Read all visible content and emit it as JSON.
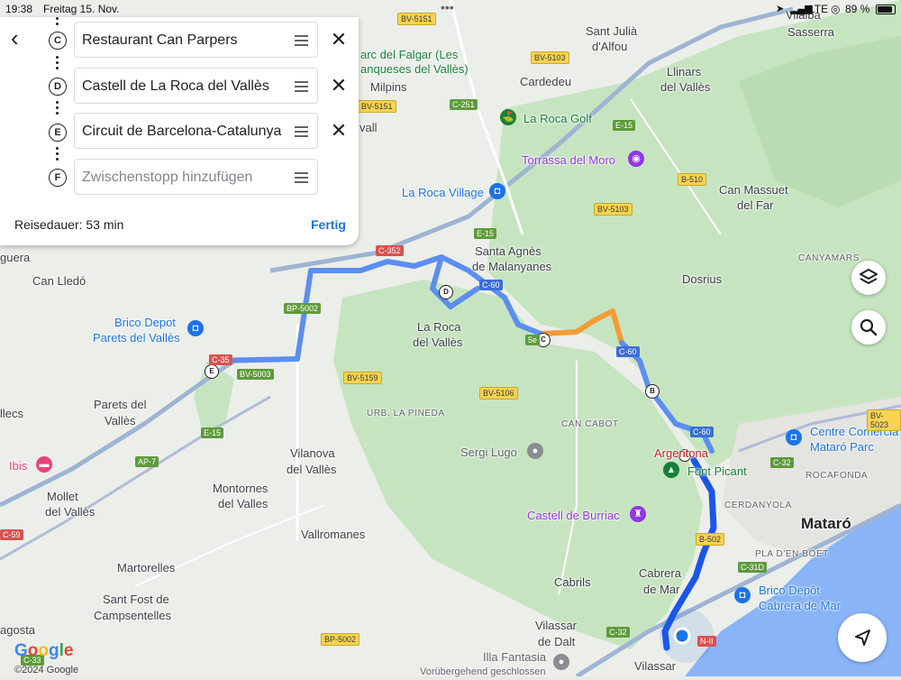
{
  "status_bar": {
    "time": "19:38",
    "date": "Freitag 15. Nov.",
    "carrier": "LTE",
    "battery": "89 %"
  },
  "directions": {
    "stops": [
      {
        "letter": "C",
        "value": "Restaurant Can Parpers"
      },
      {
        "letter": "D",
        "value": "Castell de La Roca del Vallès"
      },
      {
        "letter": "E",
        "value": "Circuit de Barcelona-Catalunya"
      },
      {
        "letter": "F",
        "value": "",
        "placeholder": "Zwischenstopp hinzufügen"
      }
    ],
    "duration": "Reisedauer: 53 min",
    "done_label": "Fertig"
  },
  "map": {
    "towns": {
      "vilalba": "Vilalba",
      "sasserra": "Sasserra",
      "sant_julia": "Sant Julià",
      "d_alfou": "d'Alfou",
      "cardedeu": "Cardedeu",
      "llinars": "Llinars",
      "del_valles": "del Vallès",
      "milpins": "Milpins",
      "vall": "vall",
      "can_massuet": "Can Massuet",
      "del_far": "del Far",
      "santa_agnes": "Santa Agnès",
      "de_malanyanes": "de Malanyanes",
      "dosrius": "Dosrius",
      "guera": "guera",
      "can_lledo": "Can Lledó",
      "la_roca": "La Roca",
      "la_roca_2": "del Vallès",
      "parets": "Parets del",
      "parets_2": "Vallès",
      "llecs": "llecs",
      "vilanova": "Vilanova",
      "vilanova_2": "del Vallès",
      "montornes": "Montornes",
      "montornes_2": "del Valles",
      "mollet": "Mollet",
      "mollet_2": "del Vallès",
      "vallromanes": "Vallromanes",
      "martorelles": "Martorelles",
      "sant_fost": "Sant Fost de",
      "sant_fost_2": "Campsentelles",
      "cabrils": "Cabrils",
      "cabrera": "Cabrera",
      "cabrera_2": "de Mar",
      "mataro": "Mataró",
      "vilassar_dalt": "Vilassar",
      "vilassar_dalt_2": "de Dalt",
      "vilassar_mar": "Vilassar",
      "agosta": "agosta"
    },
    "pois": {
      "falgar": "arc del Falgar (Les",
      "falgar_2": "anqueses del Vallès)",
      "la_roca_golf": "La Roca Golf",
      "torrassa": "Torrassa del Moro",
      "la_roca_village": "La Roca Village",
      "brico_parets": "Brico Depot",
      "brico_parets_2": "Parets del Vallès",
      "sergi_lugo": "Sergi Lugo",
      "argentona": "Argentona",
      "font_picant": "Font Picant",
      "castell_burriac": "Castell de Burriac",
      "ibis": "Ibis",
      "centre_comercial": "Centre Comercia",
      "centre_comercial_2": "Mataró Parc",
      "brico_cabrera": "Brico Depôt",
      "brico_cabrera_2": "Cabrera de Mar",
      "illa_fantasia": "Illa Fantasia",
      "illa_fantasia_status": "Vorübergehend geschlossen"
    },
    "areas": {
      "canyamars": "CANYAMARS",
      "urb_pineda": "URB. LA PINEDA",
      "can_cabot": "CAN CABOT",
      "rocafonda": "ROCAFONDA",
      "cerdanyola": "CERDANYOLA",
      "pla_boet": "PLA D'EN BOET"
    },
    "roads": {
      "bv5151a": "BV-5151",
      "bv5103a": "BV-5103",
      "bv5151b": "BV-5151",
      "c251": "C-251",
      "e15a": "E-15",
      "b510": "B-510",
      "bv5103b": "BV-5103",
      "e15b": "E-15",
      "c352": "C-352",
      "c60a": "C-60",
      "bp5002a": "BP-5002",
      "c35": "C-35",
      "bv5003": "BV-5003",
      "bv5159": "BV-5159",
      "c60b": "C-60",
      "bv5106": "BV-5106",
      "c60c": "C-60",
      "e15c": "E-15",
      "ap7": "AP-7",
      "c32a": "C-32",
      "bv5023": "BV-5023",
      "b502": "B-502",
      "c31d": "C-31D",
      "c59": "C-59",
      "bp5002b": "BP-5002",
      "c32b": "C-32",
      "n2": "N-II",
      "c33": "C-33",
      "c5e": "5e"
    },
    "route_markers": [
      "D",
      "C",
      "E",
      "B",
      "A"
    ],
    "colors": {
      "route": "#1a56e8",
      "route_light": "#5c8ef0",
      "traffic": "#f29c38",
      "water": "#8ab4f8",
      "forest": "#c6e4c0"
    }
  },
  "attribution": {
    "logo": "Google",
    "copyright": "©2024 Google"
  },
  "controls": {
    "layers_icon": "layers-icon",
    "search_icon": "search-icon",
    "locate_icon": "navigation-arrow-icon"
  }
}
